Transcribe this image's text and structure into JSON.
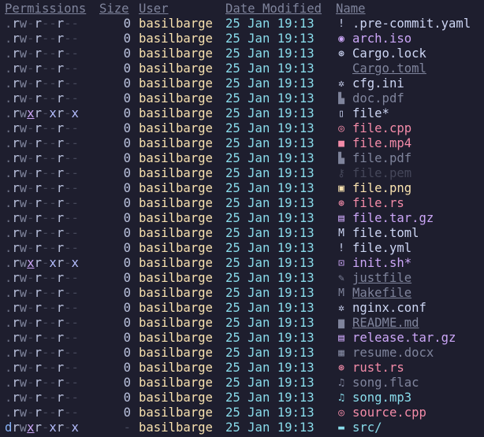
{
  "colors": {
    "background": "#1e1e2e",
    "header": "#7f849c",
    "user": "#f9e2af",
    "date": "#89dceb",
    "size": "#bac2de"
  },
  "header": {
    "permissions": "Permissions",
    "size": "Size",
    "user": "User",
    "date": "Date Modified",
    "name": "Name"
  },
  "files": [
    {
      "perms": ".rw-r--r--",
      "size": "0",
      "user": "basilbarge",
      "date": "25 Jan 19:13",
      "icon": "!",
      "icon_name": "config-exclamation-icon",
      "name": ".pre-commit.yaml",
      "color": "#cdd6f4",
      "underline": false
    },
    {
      "perms": ".rw-r--r--",
      "size": "0",
      "user": "basilbarge",
      "date": "25 Jan 19:13",
      "icon": "◉",
      "icon_name": "disc-image-icon",
      "name": "arch.iso",
      "color": "#cba6f7",
      "underline": false
    },
    {
      "perms": ".rw-r--r--",
      "size": "0",
      "user": "basilbarge",
      "date": "25 Jan 19:13",
      "icon": "⊛",
      "icon_name": "lock-file-icon",
      "name": "Cargo.lock",
      "color": "#cdd6f4",
      "underline": false
    },
    {
      "perms": ".rw-r--r--",
      "size": "0",
      "user": "basilbarge",
      "date": "25 Jan 19:13",
      "icon": "",
      "icon_name": "none",
      "name": "Cargo.toml",
      "color": "#7f849c",
      "underline": true
    },
    {
      "perms": ".rw-r--r--",
      "size": "0",
      "user": "basilbarge",
      "date": "25 Jan 19:13",
      "icon": "✲",
      "icon_name": "gear-icon",
      "name": "cfg.ini",
      "color": "#cdd6f4",
      "underline": false
    },
    {
      "perms": ".rw-r--r--",
      "size": "0",
      "user": "basilbarge",
      "date": "25 Jan 19:13",
      "icon": "▙",
      "icon_name": "pdf-document-icon",
      "name": "doc.pdf",
      "color": "#7f849c",
      "underline": false
    },
    {
      "perms": ".rwxr-xr-x",
      "size": "0",
      "user": "basilbarge",
      "date": "25 Jan 19:13",
      "icon": "▯",
      "icon_name": "file-icon",
      "name": "file*",
      "color": "#cdd6f4",
      "underline": false
    },
    {
      "perms": ".rw-r--r--",
      "size": "0",
      "user": "basilbarge",
      "date": "25 Jan 19:13",
      "icon": "◎",
      "icon_name": "cpp-source-icon",
      "name": "file.cpp",
      "color": "#f38ba8",
      "underline": false
    },
    {
      "perms": ".rw-r--r--",
      "size": "0",
      "user": "basilbarge",
      "date": "25 Jan 19:13",
      "icon": "■",
      "icon_name": "video-icon",
      "name": "file.mp4",
      "color": "#f38ba8",
      "underline": false
    },
    {
      "perms": ".rw-r--r--",
      "size": "0",
      "user": "basilbarge",
      "date": "25 Jan 19:13",
      "icon": "▙",
      "icon_name": "pdf-document-icon",
      "name": "file.pdf",
      "color": "#7f849c",
      "underline": false
    },
    {
      "perms": ".rw-r--r--",
      "size": "0",
      "user": "basilbarge",
      "date": "25 Jan 19:13",
      "icon": "⚷",
      "icon_name": "key-icon",
      "name": "file.pem",
      "color": "#45475a",
      "underline": false
    },
    {
      "perms": ".rw-r--r--",
      "size": "0",
      "user": "basilbarge",
      "date": "25 Jan 19:13",
      "icon": "▣",
      "icon_name": "image-icon",
      "name": "file.png",
      "color": "#f9e2af",
      "underline": false
    },
    {
      "perms": ".rw-r--r--",
      "size": "0",
      "user": "basilbarge",
      "date": "25 Jan 19:13",
      "icon": "⊛",
      "icon_name": "rust-source-icon",
      "name": "file.rs",
      "color": "#f38ba8",
      "underline": false
    },
    {
      "perms": ".rw-r--r--",
      "size": "0",
      "user": "basilbarge",
      "date": "25 Jan 19:13",
      "icon": "▤",
      "icon_name": "archive-icon",
      "name": "file.tar.gz",
      "color": "#cba6f7",
      "underline": false
    },
    {
      "perms": ".rw-r--r--",
      "size": "0",
      "user": "basilbarge",
      "date": "25 Jan 19:13",
      "icon": "M",
      "icon_name": "toml-config-icon",
      "name": "file.toml",
      "color": "#cdd6f4",
      "underline": false
    },
    {
      "perms": ".rw-r--r--",
      "size": "0",
      "user": "basilbarge",
      "date": "25 Jan 19:13",
      "icon": "!",
      "icon_name": "config-exclamation-icon",
      "name": "file.yml",
      "color": "#cdd6f4",
      "underline": false
    },
    {
      "perms": ".rwxr-xr-x",
      "size": "0",
      "user": "basilbarge",
      "date": "25 Jan 19:13",
      "icon": "⊡",
      "icon_name": "terminal-script-icon",
      "name": "init.sh*",
      "color": "#cba6f7",
      "underline": false
    },
    {
      "perms": ".rw-r--r--",
      "size": "0",
      "user": "basilbarge",
      "date": "25 Jan 19:13",
      "icon": "✎",
      "icon_name": "wrench-icon",
      "name": "justfile",
      "color": "#7f849c",
      "underline": true
    },
    {
      "perms": ".rw-r--r--",
      "size": "0",
      "user": "basilbarge",
      "date": "25 Jan 19:13",
      "icon": "M",
      "icon_name": "makefile-icon",
      "name": "Makefile",
      "color": "#7f849c",
      "underline": true
    },
    {
      "perms": ".rw-r--r--",
      "size": "0",
      "user": "basilbarge",
      "date": "25 Jan 19:13",
      "icon": "✲",
      "icon_name": "gear-icon",
      "name": "nginx.conf",
      "color": "#cdd6f4",
      "underline": false
    },
    {
      "perms": ".rw-r--r--",
      "size": "0",
      "user": "basilbarge",
      "date": "25 Jan 19:13",
      "icon": "▆",
      "icon_name": "markdown-icon",
      "name": "README.md",
      "color": "#7f849c",
      "underline": true
    },
    {
      "perms": ".rw-r--r--",
      "size": "0",
      "user": "basilbarge",
      "date": "25 Jan 19:13",
      "icon": "▤",
      "icon_name": "archive-icon",
      "name": "release.tar.gz",
      "color": "#cba6f7",
      "underline": false
    },
    {
      "perms": ".rw-r--r--",
      "size": "0",
      "user": "basilbarge",
      "date": "25 Jan 19:13",
      "icon": "▦",
      "icon_name": "word-document-icon",
      "name": "resume.docx",
      "color": "#7f849c",
      "underline": false
    },
    {
      "perms": ".rw-r--r--",
      "size": "0",
      "user": "basilbarge",
      "date": "25 Jan 19:13",
      "icon": "⊛",
      "icon_name": "rust-source-icon",
      "name": "rust.rs",
      "color": "#f38ba8",
      "underline": false
    },
    {
      "perms": ".rw-r--r--",
      "size": "0",
      "user": "basilbarge",
      "date": "25 Jan 19:13",
      "icon": "♫",
      "icon_name": "audio-icon",
      "name": "song.flac",
      "color": "#7f849c",
      "underline": false
    },
    {
      "perms": ".rw-r--r--",
      "size": "0",
      "user": "basilbarge",
      "date": "25 Jan 19:13",
      "icon": "♫",
      "icon_name": "audio-icon",
      "name": "song.mp3",
      "color": "#89dceb",
      "underline": false
    },
    {
      "perms": ".rw-r--r--",
      "size": "0",
      "user": "basilbarge",
      "date": "25 Jan 19:13",
      "icon": "◎",
      "icon_name": "cpp-source-icon",
      "name": "source.cpp",
      "color": "#f38ba8",
      "underline": false
    },
    {
      "perms": "drwxr-xr-x",
      "size": "-",
      "user": "basilbarge",
      "date": "25 Jan 19:13",
      "icon": "▬",
      "icon_name": "folder-icon",
      "name": "src/",
      "color": "#89dceb",
      "underline": false
    }
  ]
}
